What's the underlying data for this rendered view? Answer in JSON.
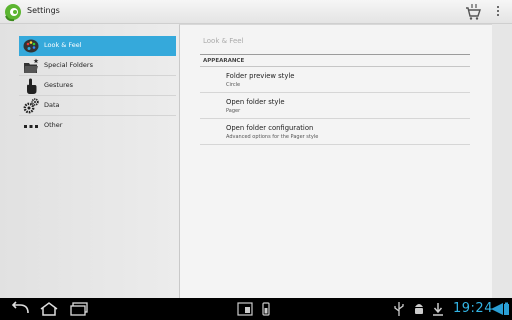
{
  "action_bar": {
    "title": "Settings",
    "app_icon": "chameleon-app-icon",
    "cart_icon": "shopping-cart-icon",
    "overflow_icon": "overflow-menu-icon"
  },
  "sidebar": {
    "items": [
      {
        "label": "Look & Feel",
        "icon": "palette-icon",
        "selected": true
      },
      {
        "label": "Special Folders",
        "icon": "folder-star-icon",
        "selected": false
      },
      {
        "label": "Gestures",
        "icon": "hand-pointer-icon",
        "selected": false
      },
      {
        "label": "Data",
        "icon": "gears-icon",
        "selected": false
      },
      {
        "label": "Other",
        "icon": "dots-icon",
        "selected": false
      }
    ]
  },
  "content": {
    "heading": "Look & Feel",
    "section": "APPEARANCE",
    "prefs": [
      {
        "title": "Folder preview style",
        "summary": "Circle"
      },
      {
        "title": "Open folder style",
        "summary": "Pager"
      },
      {
        "title": "Open folder configuration",
        "summary": "Advanced options for the Pager style"
      }
    ]
  },
  "system_bar": {
    "time": "19:24",
    "icons": [
      "back-icon",
      "home-icon",
      "recent-apps-icon",
      "screenshot-icon",
      "battery-small-icon",
      "usb-icon",
      "android-debug-icon",
      "download-icon",
      "wifi-icon",
      "battery-icon"
    ]
  },
  "colors": {
    "accent": "#35a9db",
    "clock": "#33b5e5"
  }
}
